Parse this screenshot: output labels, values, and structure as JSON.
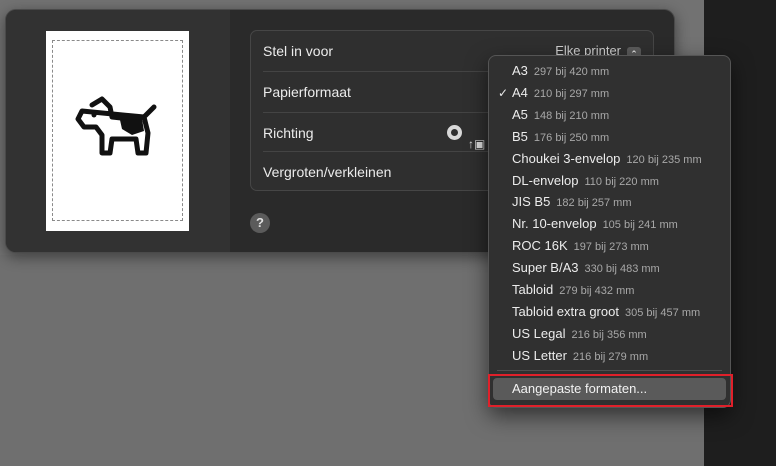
{
  "settings": {
    "stel_in_voor_label": "Stel in voor",
    "stel_in_voor_value": "Elke printer",
    "papierformaat_label": "Papierformaat",
    "richting_label": "Richting",
    "vergroten_label": "Vergroten/verkleinen"
  },
  "help": {
    "label": "?"
  },
  "paper_menu": {
    "items": [
      {
        "name": "A3",
        "size": "297 bij 420 mm",
        "checked": false
      },
      {
        "name": "A4",
        "size": "210 bij 297 mm",
        "checked": true
      },
      {
        "name": "A5",
        "size": "148 bij 210 mm",
        "checked": false
      },
      {
        "name": "B5",
        "size": "176 bij 250 mm",
        "checked": false
      },
      {
        "name": "Choukei 3-envelop",
        "size": "120 bij 235 mm",
        "checked": false
      },
      {
        "name": "DL-envelop",
        "size": "110 bij 220 mm",
        "checked": false
      },
      {
        "name": "JIS B5",
        "size": "182 bij 257 mm",
        "checked": false
      },
      {
        "name": "Nr. 10-envelop",
        "size": "105 bij 241 mm",
        "checked": false
      },
      {
        "name": "ROC 16K",
        "size": "197 bij 273 mm",
        "checked": false
      },
      {
        "name": "Super B/A3",
        "size": "330 bij 483 mm",
        "checked": false
      },
      {
        "name": "Tabloid",
        "size": "279 bij 432 mm",
        "checked": false
      },
      {
        "name": "Tabloid extra groot",
        "size": "305 bij 457 mm",
        "checked": false
      },
      {
        "name": "US Legal",
        "size": "216 bij 356 mm",
        "checked": false
      },
      {
        "name": "US Letter",
        "size": "216 bij 279 mm",
        "checked": false
      }
    ],
    "custom_label": "Aangepaste formaten..."
  },
  "colors": {
    "highlight": "#e0202a",
    "menu_bg": "#303030"
  },
  "icons": {
    "preview": "dog-icon",
    "check": "checkmark-icon",
    "stepper": "chevron-updown-icon",
    "orientation": "portrait-icon"
  }
}
